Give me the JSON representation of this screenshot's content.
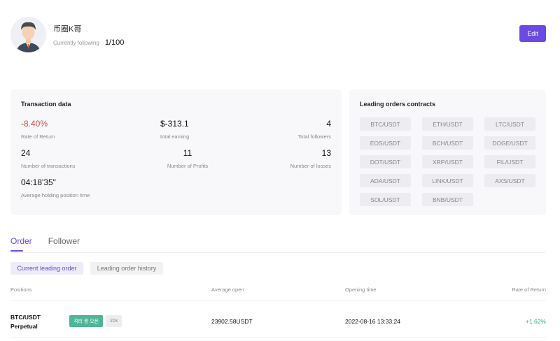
{
  "profile": {
    "name": "币圈K哥",
    "following_label": "Currently following",
    "following_count": "1/100",
    "avatar_icon": "user-avatar-icon"
  },
  "edit_label": "Edit",
  "transaction": {
    "title": "Transaction data",
    "stats": [
      {
        "value": "-8.40%",
        "label": "Rate of Return"
      },
      {
        "value": "$-313.1",
        "label": "total earning"
      },
      {
        "value": "4",
        "label": "Total followers"
      },
      {
        "value": "24",
        "label": "Number of transactions"
      },
      {
        "value": "11",
        "label": "Number of Profits"
      },
      {
        "value": "13",
        "label": "Number of losses"
      },
      {
        "value": "04:18'35\"",
        "label": "Average holding position time"
      }
    ]
  },
  "leading": {
    "title": "Leading orders contracts",
    "pairs": [
      "BTC/USDT",
      "ETH/USDT",
      "LTC/USDT",
      "EOS/USDT",
      "BCH/USDT",
      "DOGE/USDT",
      "DOT/USDT",
      "XRP/USDT",
      "FIL/USDT",
      "ADA/USDT",
      "LINK/USDT",
      "AXS/USDT",
      "SOL/USDT",
      "BNB/USDT"
    ]
  },
  "tabs": [
    {
      "label": "Order"
    },
    {
      "label": "Follower"
    }
  ],
  "sub_tabs": [
    {
      "label": "Current leading order"
    },
    {
      "label": "Leading order history"
    }
  ],
  "table": {
    "headers": [
      "Positions",
      "Average open",
      "Opening time",
      "Rate of Return"
    ],
    "rows": [
      {
        "symbol": "BTC/USDT",
        "type": "Perpetual",
        "side_tag": "격리 롱 오픈",
        "leverage": "20x",
        "avg_open": "23902.58USDT",
        "open_time": "2022-08-16 13:33:24",
        "rate": "+1.62%"
      }
    ]
  },
  "colors": {
    "accent": "#6a4ae0",
    "negative": "#c0504d",
    "positive": "#2eb37f",
    "long_tag": "#4fb598"
  }
}
